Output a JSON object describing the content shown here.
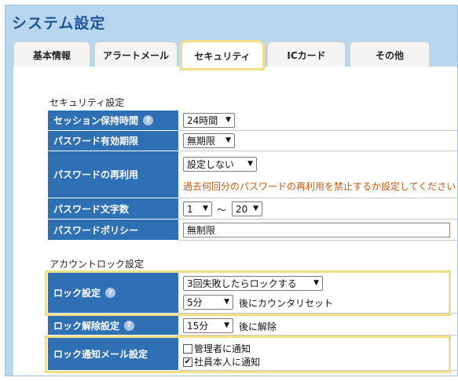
{
  "app": {
    "title": "システム設定"
  },
  "tabs": [
    {
      "label": "基本情報"
    },
    {
      "label": "アラートメール"
    },
    {
      "label": "セキュリティ"
    },
    {
      "label": "ICカード"
    },
    {
      "label": "その他"
    }
  ],
  "security": {
    "section_label": "セキュリティ設定",
    "session_timeout": {
      "label": "セッション保持時間",
      "value": "24時間"
    },
    "password_expiry": {
      "label": "パスワード有効期限",
      "value": "無期限"
    },
    "password_reuse": {
      "label": "パスワードの再利用",
      "value": "設定しない",
      "note": "過去何回分のパスワードの再利用を禁止するか設定してください"
    },
    "password_length": {
      "label": "パスワード文字数",
      "min": "1",
      "separator": "～",
      "max": "20"
    },
    "password_policy": {
      "label": "パスワードポリシー",
      "value": "無制限"
    }
  },
  "account_lock": {
    "section_label": "アカウントロック設定",
    "lock_setting": {
      "label": "ロック設定",
      "rule": "3回失敗したらロックする",
      "reset_value": "5分",
      "reset_suffix": "後にカウンタリセット"
    },
    "unlock_setting": {
      "label": "ロック解除設定",
      "value": "15分",
      "suffix": "後に解除"
    },
    "notify_setting": {
      "label": "ロック通知メール設定",
      "options": [
        {
          "label": "管理者に通知",
          "checked": false
        },
        {
          "label": "社員本人に通知",
          "checked": true
        }
      ]
    }
  },
  "help_icon": "?",
  "colors": {
    "header_bg": "#b9d6ef",
    "label_bg": "#2f6fb4",
    "highlight": "#f1de86",
    "note": "#c55a11"
  }
}
